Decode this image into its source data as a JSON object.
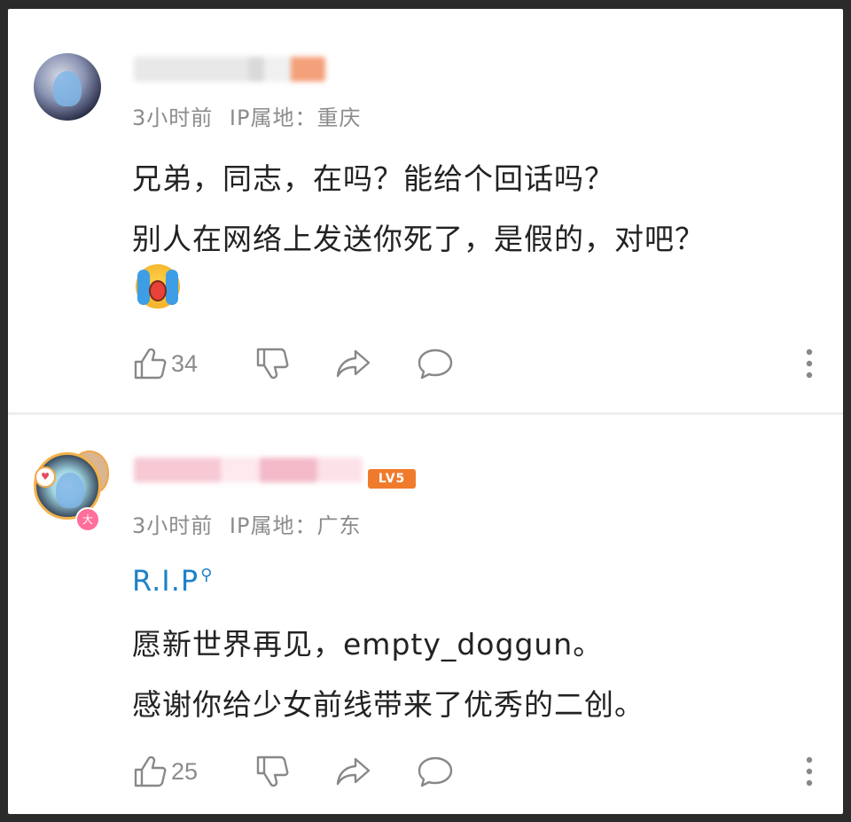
{
  "comments": [
    {
      "time": "3小时前",
      "ip_label": "IP属地：",
      "ip_region": "重庆",
      "lines": [
        "兄弟，同志，在吗？能给个回话吗？",
        "别人在网络上发送你死了，是假的，对吧？"
      ],
      "emoji": "cry-emoji",
      "likes": "34"
    },
    {
      "level": "LV5",
      "vip_badge": "大",
      "time": "3小时前",
      "ip_label": "IP属地：",
      "ip_region": "广东",
      "tag": "R.I.P",
      "lines": [
        "愿新世界再见，empty_doggun。",
        "感谢你给少女前线带来了优秀的二创。"
      ],
      "likes": "25"
    }
  ],
  "icons": {
    "like": "thumbs-up-icon",
    "dislike": "thumbs-down-icon",
    "share": "share-arrow-icon",
    "reply": "comment-bubble-icon",
    "more": "more-vertical-icon"
  },
  "colors": {
    "tag": "#1d82c8",
    "level_badge": "#f07b2c",
    "meta_text": "#8b8b8b",
    "body_text": "#222222"
  }
}
